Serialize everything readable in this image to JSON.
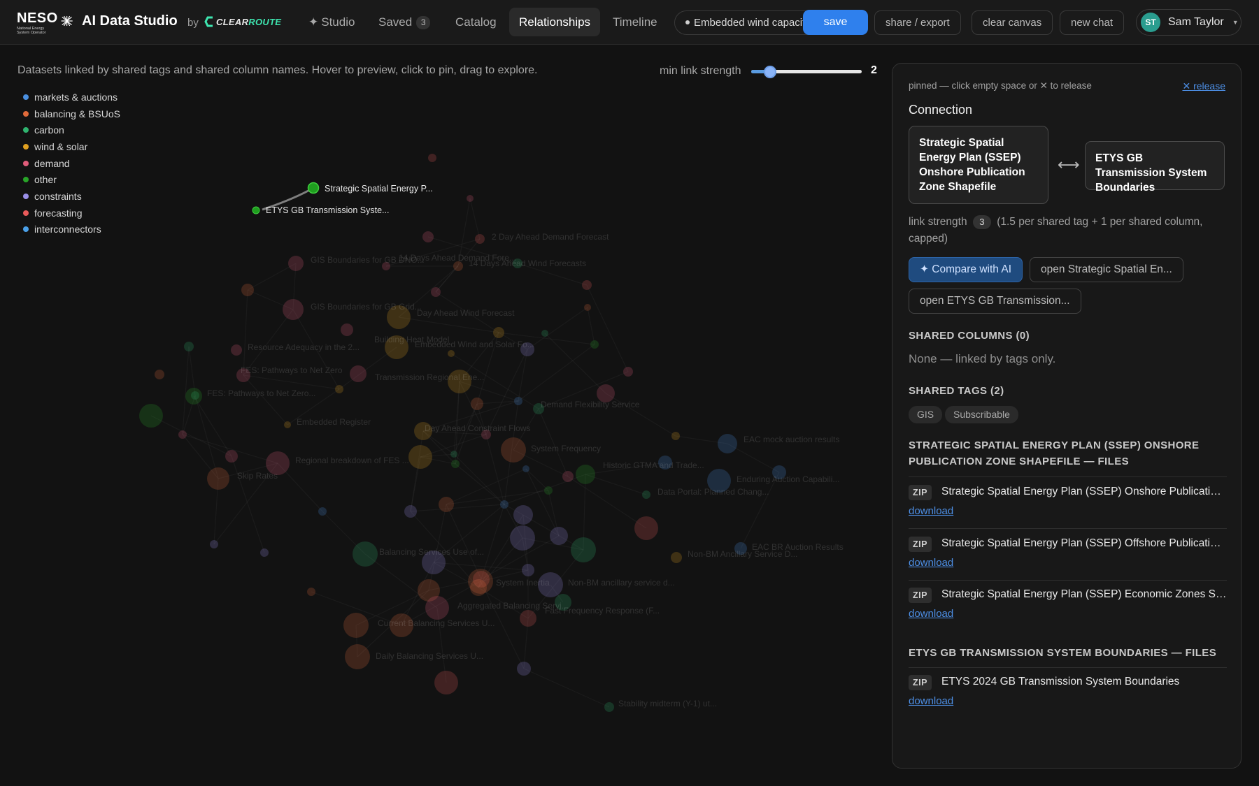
{
  "brand": {
    "logo": "NESO",
    "logo_sub": "National Energy System Operator",
    "app_title": "AI Data Studio",
    "by": "by",
    "partner_a": "CLEAR",
    "partner_b": "ROUTE"
  },
  "nav": {
    "studio": "Studio",
    "saved": "Saved",
    "saved_count": "3",
    "catalog": "Catalog",
    "relationships": "Relationships",
    "timeline": "Timeline"
  },
  "toolbar": {
    "context_chip": "Embedded wind capacity",
    "save": "save",
    "share_export": "share / export",
    "clear_canvas": "clear canvas",
    "new_chat": "new chat"
  },
  "user": {
    "initials": "ST",
    "name": "Sam Taylor"
  },
  "graph": {
    "hint": "Datasets linked by shared tags and shared column names. Hover to preview, click to pin, drag to explore.",
    "slider_label": "min link strength",
    "slider_value": "2",
    "slider_fraction": 0.17,
    "legend": [
      {
        "label": "markets & auctions",
        "color": "#4a8fe0"
      },
      {
        "label": "balancing & BSUoS",
        "color": "#e06a3a"
      },
      {
        "label": "carbon",
        "color": "#2fb36f"
      },
      {
        "label": "wind & solar",
        "color": "#e0a020"
      },
      {
        "label": "demand",
        "color": "#e05c7a"
      },
      {
        "label": "other",
        "color": "#28a428"
      },
      {
        "label": "constraints",
        "color": "#9a8fe8"
      },
      {
        "label": "forecasting",
        "color": "#e85a5a"
      },
      {
        "label": "interconnectors",
        "color": "#4aa0e8"
      }
    ],
    "active_nodes": [
      {
        "label": "Strategic Spatial Energy P..."
      },
      {
        "label": "ETYS GB Transmission Syste..."
      }
    ],
    "faded_labels": [
      "2 Day Ahead Demand Forecast",
      "GIS Boundaries for GB DNO...",
      "14 Days Ahead Demand Fore...",
      "14 Days Ahead Wind Forecasts",
      "GIS Boundaries for GB Grid...",
      "Day Ahead Wind Forecast",
      "Building Heat Model",
      "Embedded Wind and Solar Fo...",
      "Resource Adequacy in the 2...",
      "FES: Pathways to Net Zero",
      "FES: Pathways to Net Zero...",
      "Transmission Regional Ene...",
      "Demand Flexibility Service",
      "Embedded Register",
      "Day Ahead Constraint Flows",
      "System Frequency",
      "Regional breakdown of FES ...",
      "Skip Rates",
      "Historic GTMA and Trade...",
      "EAC mock auction results",
      "Enduring Auction Capabili...",
      "Data Portal: Planned Chang...",
      "EAC BR Auction Results",
      "Non-BM Ancillary Service D...",
      "Balancing Services Use of...",
      "System Inertia",
      "Non-BM ancillary service d...",
      "Aggregated Balancing Servi...",
      "Fast Frequency Response (F...",
      "Current Balancing Services U...",
      "Daily Balancing Services U...",
      "Stability midterm (Y-1) ut..."
    ]
  },
  "panel": {
    "pinned_hint": "pinned — click empty space or ✕ to release",
    "release": "✕ release",
    "title": "Connection",
    "node_a": "Strategic Spatial Energy Plan (SSEP) Onshore Publication Zone Shapefile",
    "node_b": "ETYS GB Transmission System Boundaries",
    "strength_label": "link strength",
    "strength_value": "3",
    "strength_note": "(1.5 per shared tag + 1 per shared column, capped)",
    "compare": "✦ Compare with AI",
    "open_a": "open Strategic Spatial En...",
    "open_b": "open ETYS GB Transmission...",
    "shared_columns_h": "SHARED COLUMNS (0)",
    "shared_columns_none": "None — linked by tags only.",
    "shared_tags_h": "SHARED TAGS (2)",
    "tags": [
      "GIS",
      "Subscribable"
    ],
    "files_a_h": "STRATEGIC SPATIAL ENERGY PLAN (SSEP) ONSHORE PUBLICATION ZONE SHAPEFILE — FILES",
    "files_a": [
      {
        "type": "ZIP",
        "name": "Strategic Spatial Energy Plan (SSEP) Onshore Publication Zone Shapefile",
        "link": "download"
      },
      {
        "type": "ZIP",
        "name": "Strategic Spatial Energy Plan (SSEP) Offshore Publication Zone Shapefile",
        "link": "download"
      },
      {
        "type": "ZIP",
        "name": "Strategic Spatial Energy Plan (SSEP) Economic Zones Shapefile",
        "link": "download"
      }
    ],
    "files_b_h": "ETYS GB TRANSMISSION SYSTEM BOUNDARIES — FILES",
    "files_b": [
      {
        "type": "ZIP",
        "name": "ETYS 2024 GB Transmission System Boundaries",
        "link": "download"
      }
    ]
  }
}
